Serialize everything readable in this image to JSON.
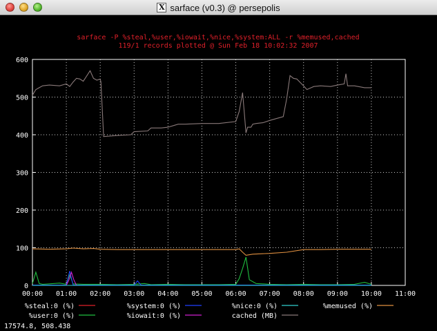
{
  "window": {
    "title": "sarface (v0.3) @ persepolis",
    "app_icon": "x11-icon"
  },
  "chart_data": {
    "type": "line",
    "title": "sarface -P %steal,%user,%iowait,%nice,%system:ALL -r %memused,cached",
    "subtitle": "119/1 records plotted @ Sun Feb 18 10:02:32 2007",
    "x_ticks": [
      "00:00",
      "01:00",
      "02:00",
      "03:00",
      "04:00",
      "05:00",
      "06:00",
      "07:00",
      "08:00",
      "09:00",
      "10:00",
      "11:00"
    ],
    "y_ticks": [
      "0",
      "100",
      "200",
      "300",
      "400",
      "500",
      "600"
    ],
    "xlim": [
      0,
      11
    ],
    "ylim": [
      0,
      600
    ],
    "grid": true,
    "legend_position": "bottom",
    "series": [
      {
        "name": "%steal:0 (%)",
        "color": "#e0202a",
        "x": [
          0,
          10
        ],
        "y": [
          0,
          0
        ]
      },
      {
        "name": "%user:0 (%)",
        "color": "#20c040",
        "x": [
          0,
          0.1,
          0.2,
          0.3,
          0.5,
          0.8,
          1.0,
          1.1,
          1.2,
          1.5,
          2.0,
          2.5,
          3.0,
          3.3,
          3.5,
          4.0,
          4.5,
          5.0,
          5.5,
          6.0,
          6.1,
          6.2,
          6.3,
          6.4,
          6.6,
          7.0,
          7.5,
          8.0,
          8.5,
          9.0,
          9.5,
          9.8,
          10.0
        ],
        "y": [
          5,
          35,
          5,
          3,
          4,
          6,
          3,
          28,
          4,
          3,
          3,
          2,
          3,
          5,
          2,
          3,
          2,
          2,
          2,
          3,
          18,
          45,
          75,
          15,
          5,
          3,
          2,
          3,
          2,
          2,
          3,
          8,
          3
        ]
      },
      {
        "name": "%system:0 (%)",
        "color": "#2040ff",
        "x": [
          0,
          1.0,
          1.1,
          1.2,
          1.3,
          2.0,
          3.0,
          3.1,
          3.2,
          3.3,
          4.0,
          5.0,
          6.0,
          7.0,
          8.0,
          9.0,
          10.0
        ],
        "y": [
          1,
          1,
          38,
          1,
          1,
          1,
          1,
          12,
          1,
          1,
          1,
          1,
          1,
          1,
          1,
          1,
          1
        ]
      },
      {
        "name": "%iowait:0 (%)",
        "color": "#d020d0",
        "x": [
          0,
          1.0,
          1.08,
          1.15,
          1.22,
          1.3,
          2.0,
          3.0,
          4.0,
          5.0,
          6.0,
          7.0,
          8.0,
          9.0,
          10.0
        ],
        "y": [
          0,
          0,
          15,
          35,
          15,
          0,
          0,
          0,
          0,
          0,
          0,
          0,
          0,
          0,
          0
        ]
      },
      {
        "name": "%nice:0 (%)",
        "color": "#30d0d0",
        "x": [
          0,
          10
        ],
        "y": [
          0,
          0
        ]
      },
      {
        "name": "cached (MB)",
        "color": "#8a7a7a",
        "x": [
          0,
          0.1,
          0.2,
          0.3,
          0.5,
          0.8,
          1.0,
          1.1,
          1.2,
          1.3,
          1.4,
          1.5,
          1.7,
          1.8,
          1.9,
          2.0,
          2.02,
          2.1,
          2.5,
          2.9,
          3.0,
          3.4,
          3.5,
          3.8,
          4.0,
          4.3,
          4.5,
          5.0,
          5.5,
          6.0,
          6.1,
          6.2,
          6.25,
          6.3,
          6.35,
          6.45,
          6.5,
          6.6,
          6.8,
          7.0,
          7.4,
          7.5,
          7.6,
          7.7,
          7.8,
          8.0,
          8.1,
          8.3,
          8.5,
          8.8,
          9.0,
          9.2,
          9.25,
          9.3,
          9.5,
          9.8,
          10.0
        ],
        "y": [
          505,
          520,
          525,
          530,
          532,
          530,
          535,
          528,
          540,
          550,
          548,
          542,
          570,
          550,
          545,
          548,
          540,
          395,
          398,
          400,
          408,
          410,
          418,
          418,
          420,
          428,
          428,
          430,
          430,
          435,
          462,
          512,
          460,
          405,
          420,
          420,
          428,
          430,
          432,
          438,
          448,
          495,
          557,
          550,
          548,
          530,
          520,
          528,
          530,
          528,
          532,
          535,
          562,
          530,
          530,
          525,
          525
        ]
      },
      {
        "name": "%memused (%)",
        "color": "#e09040",
        "x": [
          0,
          0.5,
          1.0,
          1.2,
          1.5,
          1.8,
          2.0,
          2.5,
          3.0,
          4.0,
          5.0,
          6.0,
          6.1,
          6.2,
          6.3,
          6.5,
          7.0,
          7.5,
          8.0,
          8.5,
          9.0,
          9.5,
          10.0
        ],
        "y": [
          97,
          96,
          97,
          99,
          97,
          98,
          96,
          95,
          95,
          95,
          95,
          95,
          97,
          88,
          80,
          83,
          85,
          88,
          95,
          95,
          96,
          96,
          96
        ]
      }
    ]
  },
  "status": {
    "coords": "17574.8,  508.438"
  }
}
